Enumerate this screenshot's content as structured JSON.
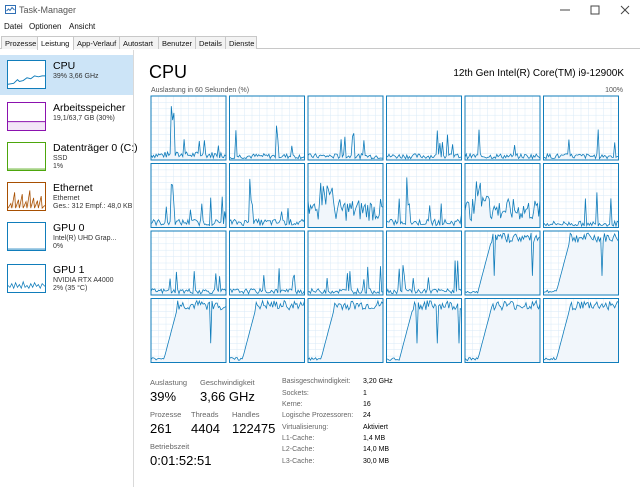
{
  "window": {
    "title": "Task-Manager"
  },
  "menu": [
    "Datei",
    "Optionen",
    "Ansicht"
  ],
  "tabs": [
    {
      "label": "Prozesse"
    },
    {
      "label": "Leistung"
    },
    {
      "label": "App-Verlauf"
    },
    {
      "label": "Autostart"
    },
    {
      "label": "Benutzer"
    },
    {
      "label": "Details"
    },
    {
      "label": "Dienste"
    }
  ],
  "sidebar": {
    "items": [
      {
        "name": "CPU",
        "sub1": "39% 3,66 GHz",
        "sub2": "",
        "sub3": ""
      },
      {
        "name": "Arbeitsspeicher",
        "sub1": "19,1/63,7 GB (30%)",
        "sub2": "",
        "sub3": ""
      },
      {
        "name": "Datenträger 0 (C:)",
        "sub1": "SSD",
        "sub2": "1%",
        "sub3": ""
      },
      {
        "name": "Ethernet",
        "sub1": "Ethernet",
        "sub2": "Ges.: 312 Empf.: 48,0 KB",
        "sub3": ""
      },
      {
        "name": "GPU 0",
        "sub1": "Intel(R) UHD Grap...",
        "sub2": "0%",
        "sub3": ""
      },
      {
        "name": "GPU 1",
        "sub1": "NVIDIA RTX A4000",
        "sub2": "2% (35 °C)",
        "sub3": ""
      }
    ]
  },
  "main": {
    "title": "CPU",
    "model": "12th Gen Intel(R) Core(TM) i9-12900K",
    "util_label": "Auslastung in 60 Sekunden (%)",
    "util_max": "100%"
  },
  "stats": {
    "auslastung_label": "Auslastung",
    "auslastung": "39%",
    "geschw_label": "Geschwindigkeit",
    "geschw": "3,66 GHz",
    "prozesse_label": "Prozesse",
    "prozesse": "261",
    "threads_label": "Threads",
    "threads": "4404",
    "handles_label": "Handles",
    "handles": "122475",
    "betriebszeit_label": "Betriebszeit",
    "betriebszeit": "0:01:52:51"
  },
  "properties": [
    {
      "k": "Basisgeschwindigkeit:",
      "v": "3,20 GHz"
    },
    {
      "k": "Sockets:",
      "v": "1"
    },
    {
      "k": "Kerne:",
      "v": "16"
    },
    {
      "k": "Logische Prozessoren:",
      "v": "24"
    },
    {
      "k": "Virtualisierung:",
      "v": "Aktiviert"
    },
    {
      "k": "L1-Cache:",
      "v": "1,4 MB"
    },
    {
      "k": "L2-Cache:",
      "v": "14,0 MB"
    },
    {
      "k": "L3-Cache:",
      "v": "30,0 MB"
    }
  ],
  "colors": {
    "cpu": "#117dbb",
    "memory": "#8b12ae",
    "disk": "#4da60c",
    "ethernet": "#a74f01",
    "gpu": "#117dbb",
    "selected": "#cce4f7"
  },
  "core_patterns": [
    "spike",
    "low",
    "low",
    "low",
    "low",
    "low",
    "spike",
    "spike",
    "noisy",
    "spike",
    "noisy",
    "low",
    "low",
    "low",
    "low",
    "low",
    "ramp",
    "ramp",
    "ramp",
    "ramp",
    "ramp",
    "ramp",
    "ramp",
    "ramp"
  ]
}
